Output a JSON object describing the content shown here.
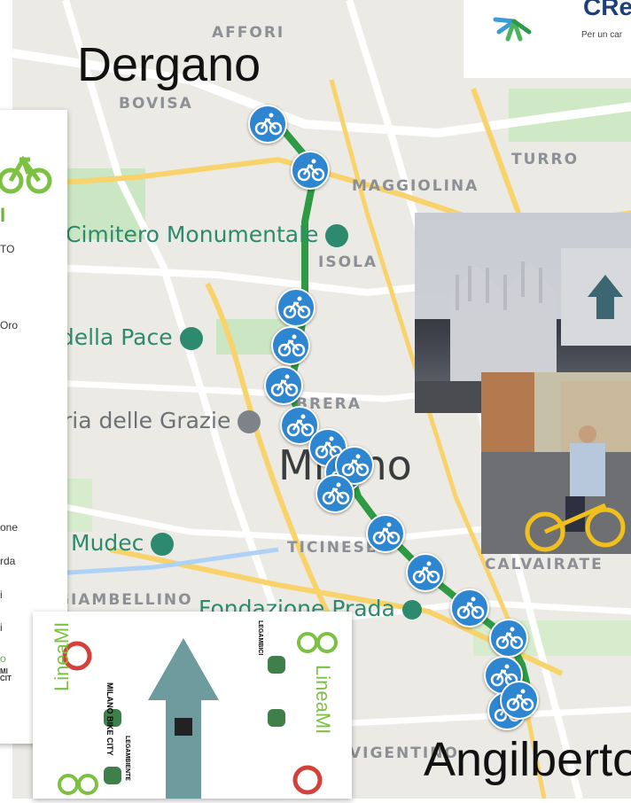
{
  "map": {
    "area_labels": [
      "AFFORI",
      "BOVISA",
      "TURRO",
      "MAGGIOLINA",
      "ISOLA",
      "BRERA",
      "TICINESE",
      "CALVAIRATE",
      "GIAMBELLINO",
      "VIGENTINO"
    ],
    "poi_labels": [
      "Cimitero Monumentale",
      "Arco della Pace",
      "Santa Maria delle Grazie",
      "Mudec",
      "Fondazione Prada"
    ],
    "city_label": "Milano",
    "route_color": "#2e9a45",
    "pin_color": "#2f86d0",
    "pin_icon": "bicycle-icon",
    "pin_count": 17
  },
  "overlay": {
    "start": "Dergano",
    "end": "Angilberto"
  },
  "logo": {
    "name": "CRe",
    "tagline": "Per un car",
    "icon": "sunburst-logo"
  },
  "side_panel": {
    "title": "I",
    "lines": [
      "TO",
      "Oro",
      "one",
      "rda",
      "i",
      "i",
      "o"
    ],
    "badge": "MI CIT"
  },
  "sign": {
    "brand": "LineaMI",
    "partners": [
      "MILANO BIKE CITY",
      "LEGAMBIENTE",
      "LEGAMBICI"
    ],
    "arrow_color": "#6e9b9d",
    "accent": "#7cc142"
  }
}
